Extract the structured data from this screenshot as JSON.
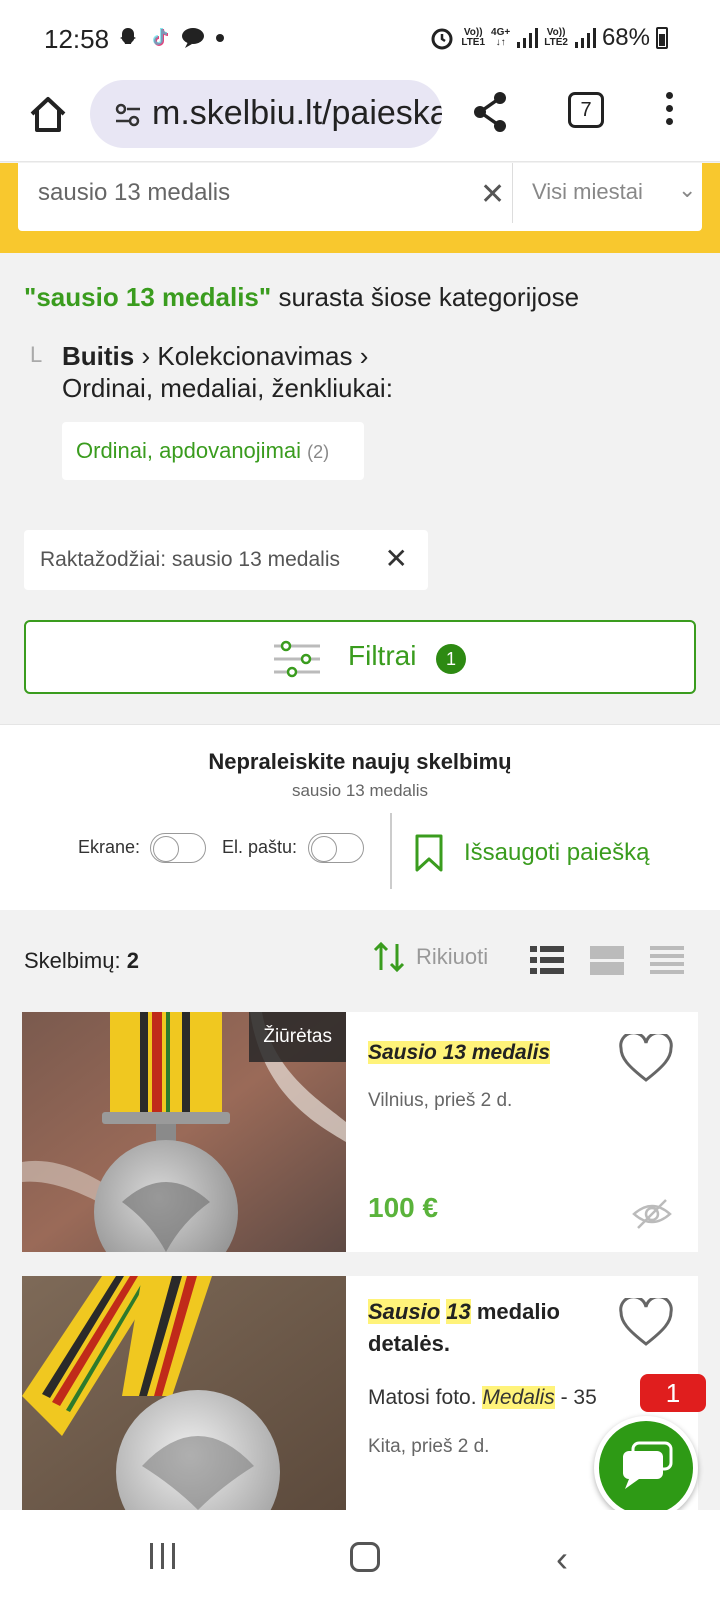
{
  "status_bar": {
    "time": "12:58",
    "signal1_top": "Vo))",
    "signal1_bottom": "LTE1",
    "net_top": "4G+",
    "net_bottom": "↓↑",
    "signal2_top": "Vo))",
    "signal2_bottom": "LTE2",
    "battery": "68%",
    "icons": [
      "snapchat-icon",
      "tiktok-icon",
      "chat-icon",
      "dot-icon",
      "alarm-icon",
      "signal-icon",
      "battery-icon"
    ]
  },
  "browser": {
    "url": "m.skelbiu.lt/paieska",
    "tab_count": "7"
  },
  "search": {
    "query": "sausio 13 medalis",
    "city_placeholder": "Visi miestai"
  },
  "categories": {
    "query_quoted": "\"sausio 13 medalis\"",
    "found_text": " surasta šiose kategorijose",
    "tree_marker": "L",
    "path_root": "Buitis",
    "path_mid": "Kolekcionavimas",
    "path_leaf": "Ordinai, medaliai, ženkliukai:",
    "sub_label": "Ordinai, apdovanojimai",
    "sub_count": "(2)"
  },
  "keyword_chip": {
    "label": "Raktažodžiai: sausio 13 medalis"
  },
  "filters": {
    "label": "Filtrai",
    "badge": "1"
  },
  "save_search": {
    "title": "Nepraleiskite naujų skelbimų",
    "subtitle": "sausio 13 medalis",
    "screen_label": "Ekrane:",
    "email_label": "El. paštu:",
    "save_label": "Išsaugoti paiešką"
  },
  "listing": {
    "count_label": "Skelbimų:",
    "count": "2",
    "sort_label": "Rikiuoti"
  },
  "cards": [
    {
      "badge": "Žiūrėtas",
      "title": "Sausio 13 medalis",
      "meta": "Vilnius, prieš 2 d.",
      "price": "100 €"
    },
    {
      "title_part1": "Sausio",
      "title_part2": "13",
      "title_part3": " medalio detalės.",
      "desc_part1": "Matosi foto. ",
      "desc_hl": "Medalis",
      "desc_part2": " - 35",
      "meta": "Kita, prieš 2 d."
    }
  ],
  "chat": {
    "badge": "1"
  },
  "colors": {
    "accent_green": "#3a9c1e",
    "price_green": "#5ab33b",
    "search_yellow": "#f8c82e",
    "highlight": "#fff37a",
    "badge_red": "#e01e1e"
  }
}
